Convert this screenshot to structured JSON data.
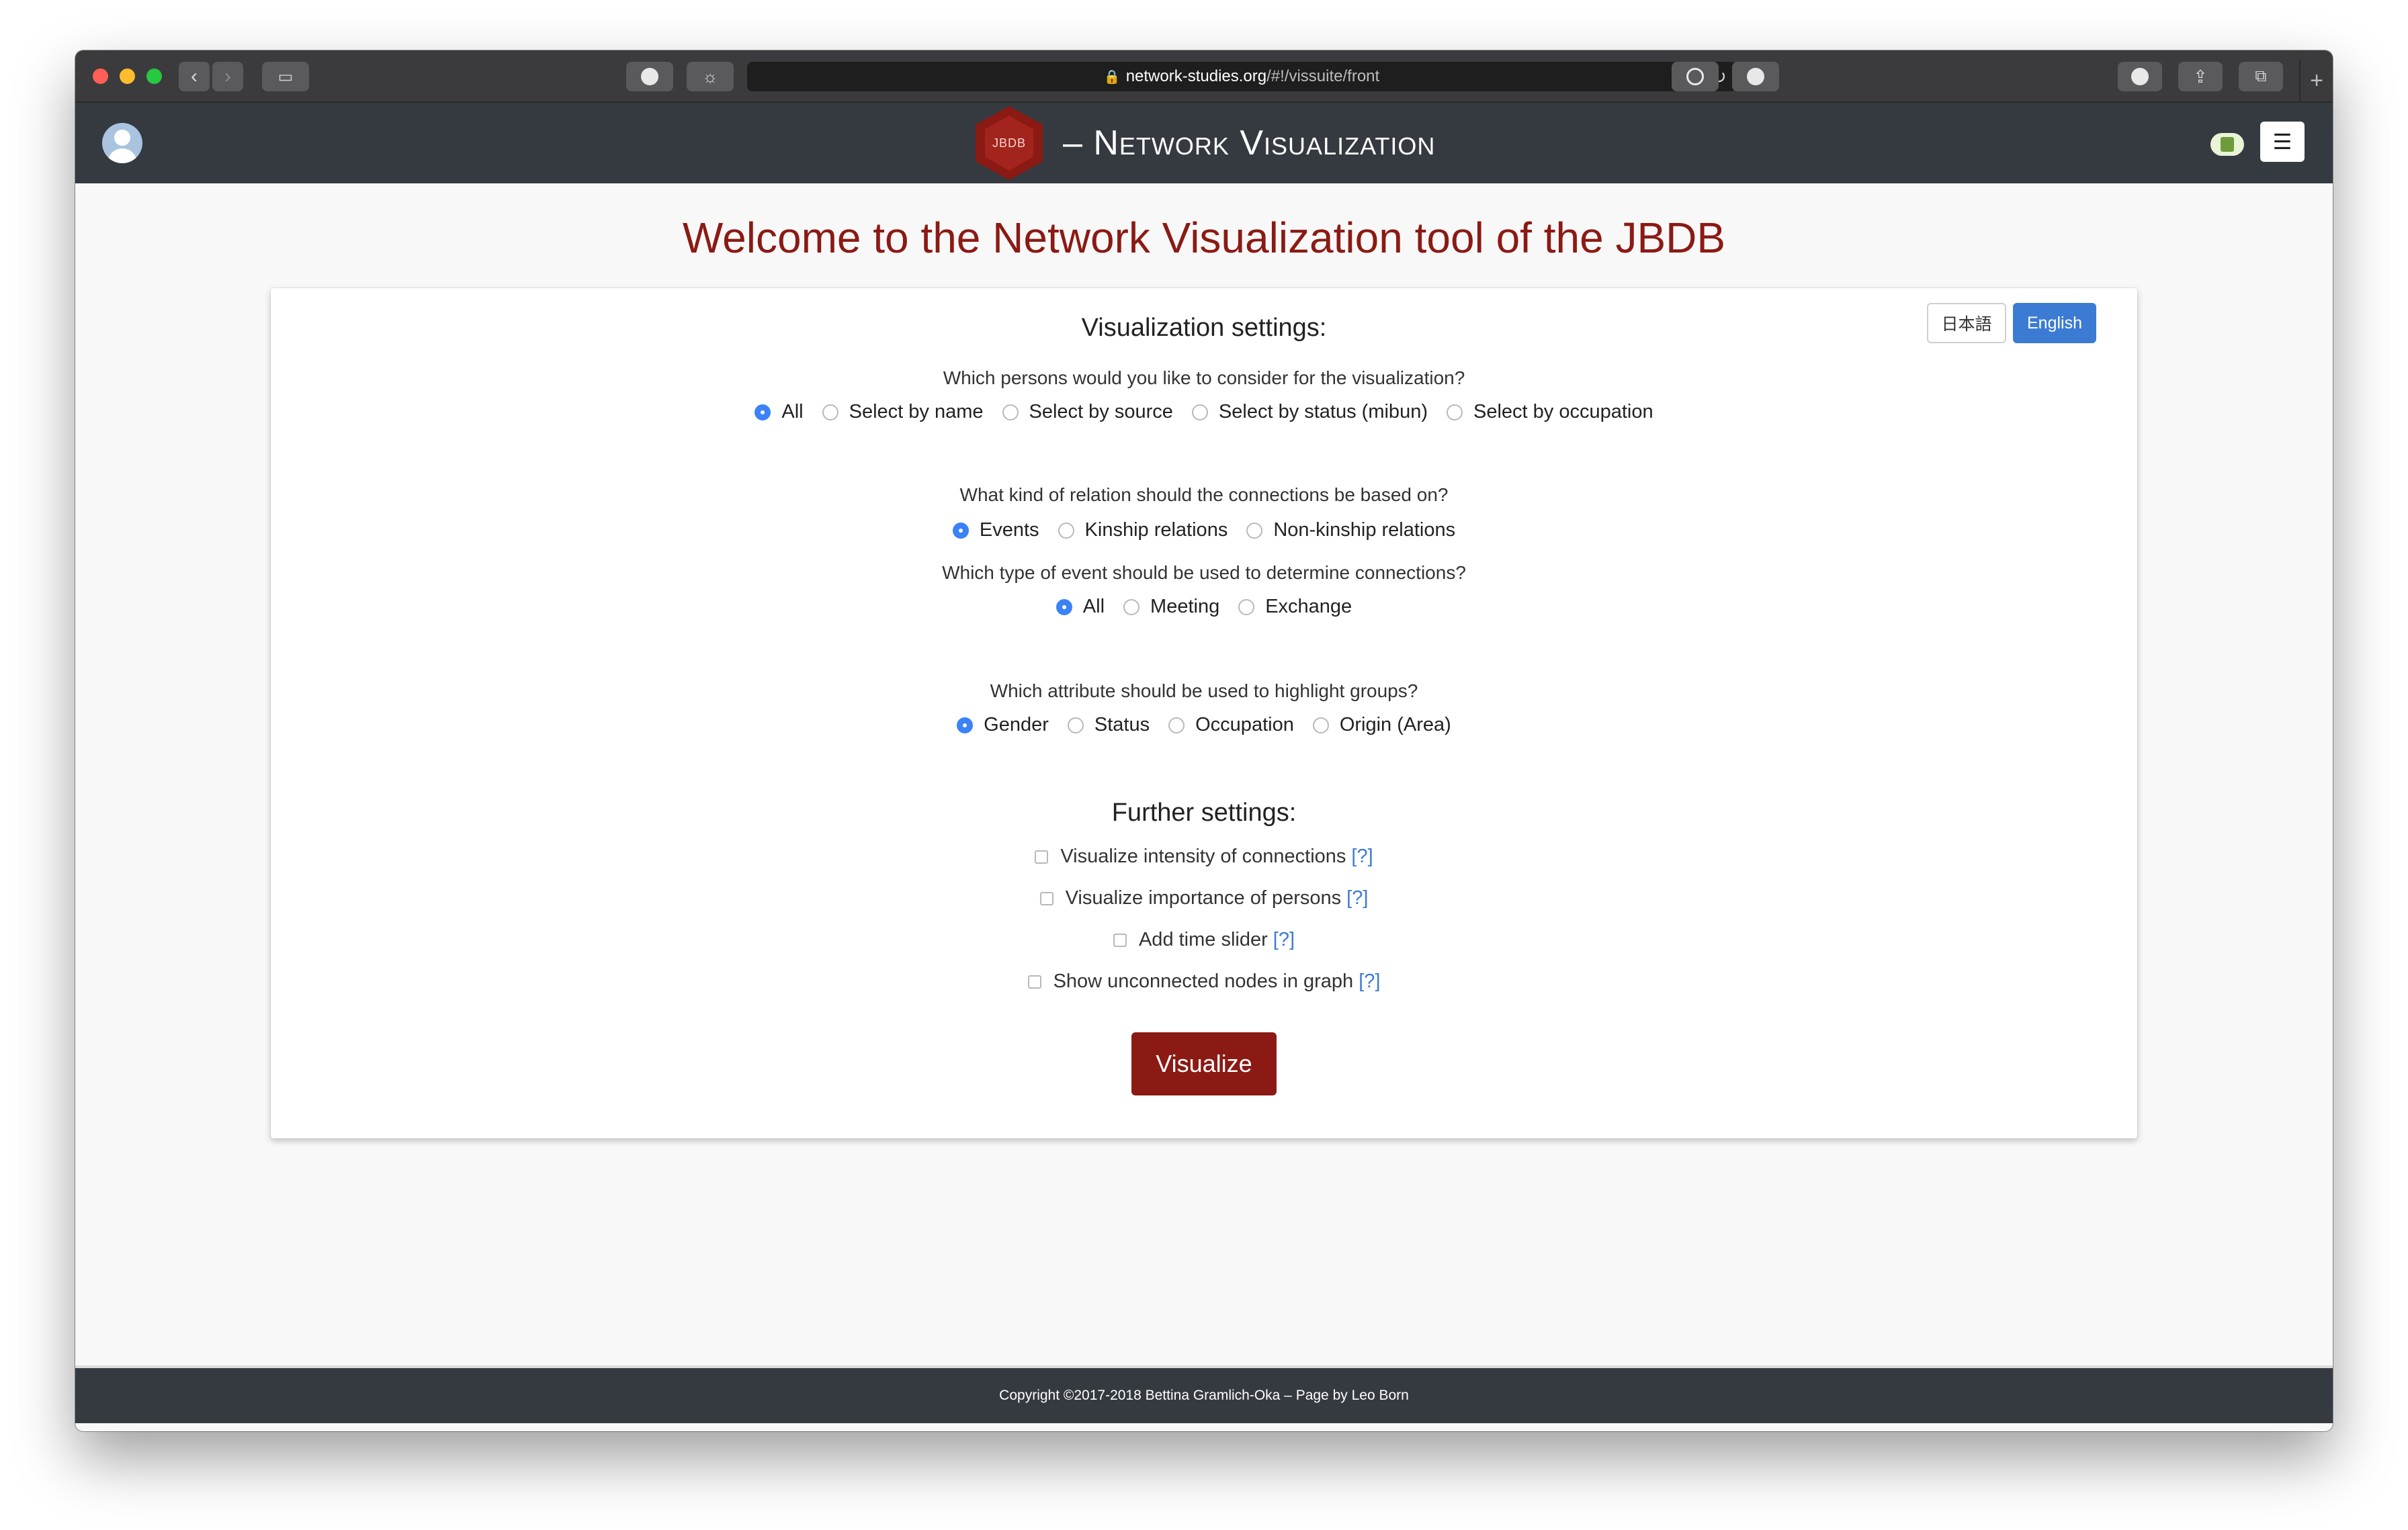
{
  "browser": {
    "url_host": "network-studies.org",
    "url_path": "/#!/vissuite/front"
  },
  "header": {
    "logo_text": "JBDB",
    "title": "– Network Visualization"
  },
  "page": {
    "title": "Welcome to the Network Visualization tool of the JBDB"
  },
  "language": {
    "japanese": "日本語",
    "english": "English"
  },
  "settings": {
    "heading": "Visualization settings:",
    "persons": {
      "question": "Which persons would you like to consider for the visualization?",
      "options": [
        "All",
        "Select by name",
        "Select by source",
        "Select by status (mibun)",
        "Select by occupation"
      ],
      "selected": "All"
    },
    "relation": {
      "question": "What kind of relation should the connections be based on?",
      "options": [
        "Events",
        "Kinship relations",
        "Non-kinship relations"
      ],
      "selected": "Events"
    },
    "event_type": {
      "question": "Which type of event should be used to determine connections?",
      "options": [
        "All",
        "Meeting",
        "Exchange"
      ],
      "selected": "All"
    },
    "attribute": {
      "question": "Which attribute should be used to highlight groups?",
      "options": [
        "Gender",
        "Status",
        "Occupation",
        "Origin (Area)"
      ],
      "selected": "Gender"
    }
  },
  "further": {
    "heading": "Further settings:",
    "help_label": "[?]",
    "options": [
      {
        "label": "Visualize intensity of connections",
        "checked": false
      },
      {
        "label": "Visualize importance of persons",
        "checked": false
      },
      {
        "label": "Add time slider",
        "checked": false
      },
      {
        "label": "Show unconnected nodes in graph",
        "checked": false
      }
    ]
  },
  "actions": {
    "visualize": "Visualize"
  },
  "footer": {
    "text": "Copyright ©2017-2018 Bettina Gramlich-Oka – Page by Leo Born"
  }
}
